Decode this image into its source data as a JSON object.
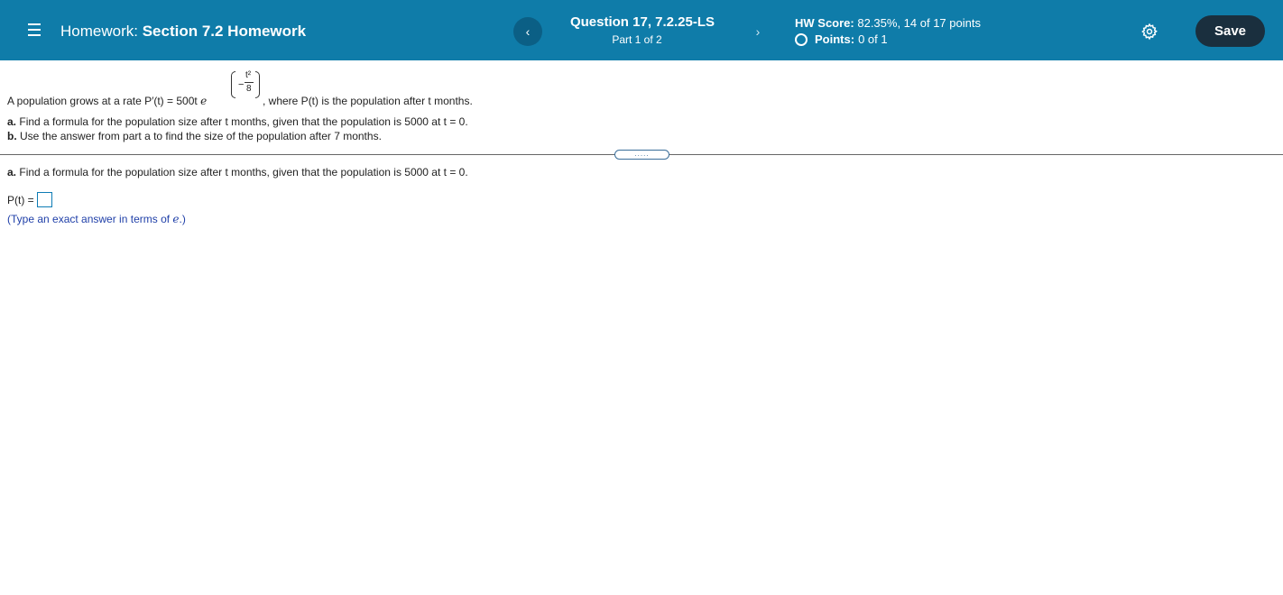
{
  "header": {
    "hw_label": "Homework:",
    "hw_name": "Section 7.2 Homework",
    "question_title": "Question 17, 7.2.25-LS",
    "question_part": "Part 1 of 2",
    "prev_icon": "chevron-left-icon",
    "next_icon": "chevron-right-icon",
    "score_label": "HW Score:",
    "score_value": "82.35%, 14 of 17 points",
    "points_label": "Points:",
    "points_value": "0 of 1",
    "settings_icon": "gear-icon",
    "save_label": "Save",
    "colors": {
      "bar": "#0f7ca9",
      "save_bg": "#1a2f3e",
      "prev_bg": "#0b5f85"
    }
  },
  "problem": {
    "intro_prefix": "A population grows at a rate P′(t) = 500t",
    "e_symbol": "e",
    "exp_minus": "−",
    "exp_num": "t²",
    "exp_den": "8",
    "intro_suffix": ", where P(t) is the population after t months.",
    "part_a_label": "a.",
    "part_a_text": "Find a formula for the population size after t months, given that the population is 5000 at t = 0.",
    "part_b_label": "b.",
    "part_b_text": "Use the answer from part a to find the size of the population after 7 months."
  },
  "expand_label": ".....",
  "answer": {
    "part_label": "a.",
    "question_text": "Find a formula for the population size after t months, given that the population is 5000 at t = 0.",
    "field_label": "P(t) =",
    "value": "",
    "hint_prefix": "(Type an exact answer in terms of ",
    "hint_e": "e",
    "hint_suffix": ".)"
  }
}
